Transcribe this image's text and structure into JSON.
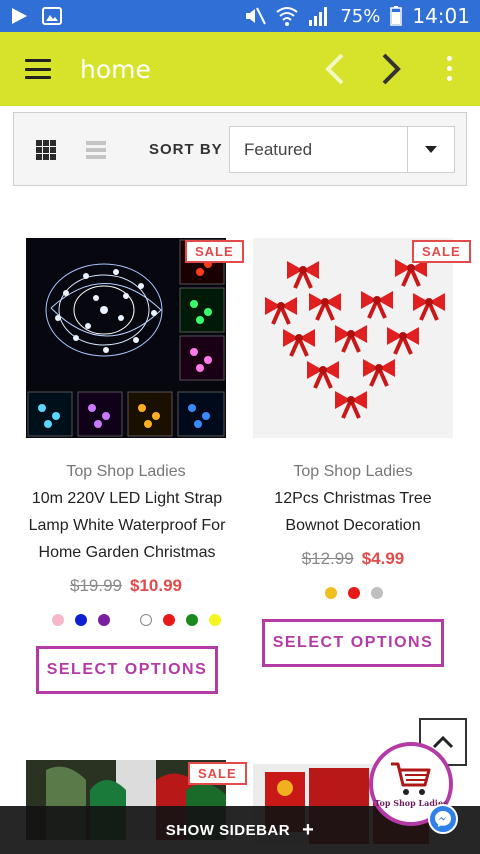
{
  "status_bar": {
    "battery": "75%",
    "time": "14:01",
    "icons": [
      "play-icon",
      "image-icon",
      "mute-icon",
      "wifi-icon",
      "signal-icon",
      "battery-icon"
    ]
  },
  "app_bar": {
    "title": "home",
    "color": "#d6e32a"
  },
  "toolbar": {
    "sort_label": "SORT BY",
    "sort_value": "Featured"
  },
  "products": [
    {
      "badge": "SALE",
      "vendor": "Top Shop Ladies",
      "title_lines": [
        "10m 220V LED Light Strap",
        "Lamp White Waterproof For",
        "Home Garden Christmas"
      ],
      "price_old": "$19.99",
      "price_new": "$10.99",
      "swatches": [
        "#f5b8c8",
        "#1020d0",
        "#7a1fa0",
        "#ffffff",
        "#e81818",
        "#1a8a1a",
        "#f5f520"
      ],
      "button": "SELECT OPTIONS"
    },
    {
      "badge": "SALE",
      "vendor": "Top Shop Ladies",
      "title_lines": [
        "12Pcs Christmas Tree",
        "Bownot Decoration"
      ],
      "price_old": "$12.99",
      "price_new": "$4.99",
      "swatches": [
        "#f0c020",
        "#e81818",
        "#c0c0c0"
      ],
      "button": "SELECT OPTIONS"
    }
  ],
  "bottom_row": {
    "badge": "SALE"
  },
  "cart": {
    "label": "Top Shop Ladies"
  },
  "bottom_bar": {
    "label": "SHOW SIDEBAR",
    "plus": "+"
  }
}
